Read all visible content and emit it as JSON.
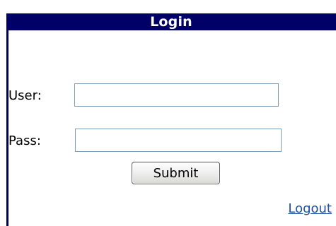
{
  "login_panel": {
    "title": "Login",
    "user_label": "User:",
    "user_value": "",
    "pass_label": "Pass:",
    "pass_value": "",
    "submit_label": "Submit",
    "logout_label": "Logout"
  },
  "colors": {
    "title_bar_bg": "#000066",
    "title_text": "#ffffff",
    "link": "#1f4fa3",
    "field_border": "#7f9db9"
  }
}
